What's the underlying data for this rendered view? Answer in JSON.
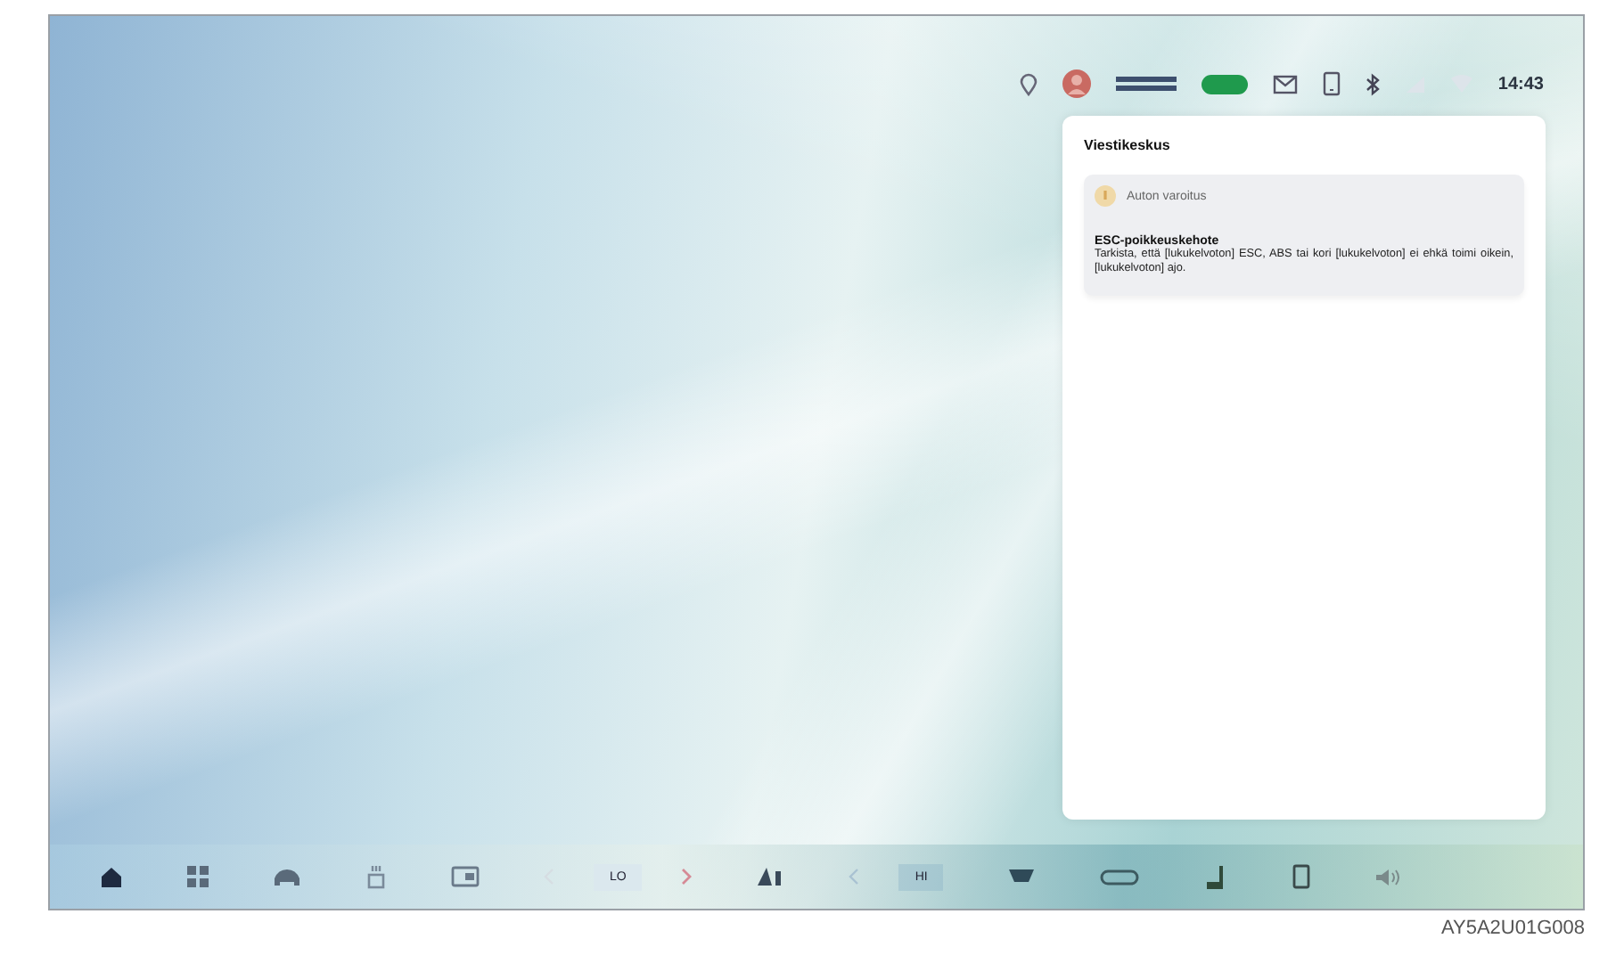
{
  "status_bar": {
    "time": "14:43"
  },
  "notification_center": {
    "title": "Viestikeskus",
    "cards": [
      {
        "category": "Auton varoitus",
        "title": "ESC-poikkeuskehote",
        "body": "Tarkista, että [lukukelvoton] ESC, ABS tai kori [lukukelvoton] ei ehkä toimi oikein, [lukukelvoton] ajo."
      }
    ]
  },
  "dock": {
    "left_temperature": "LO",
    "right_temperature": "HI"
  },
  "figure_code": "AY5A2U01G008"
}
